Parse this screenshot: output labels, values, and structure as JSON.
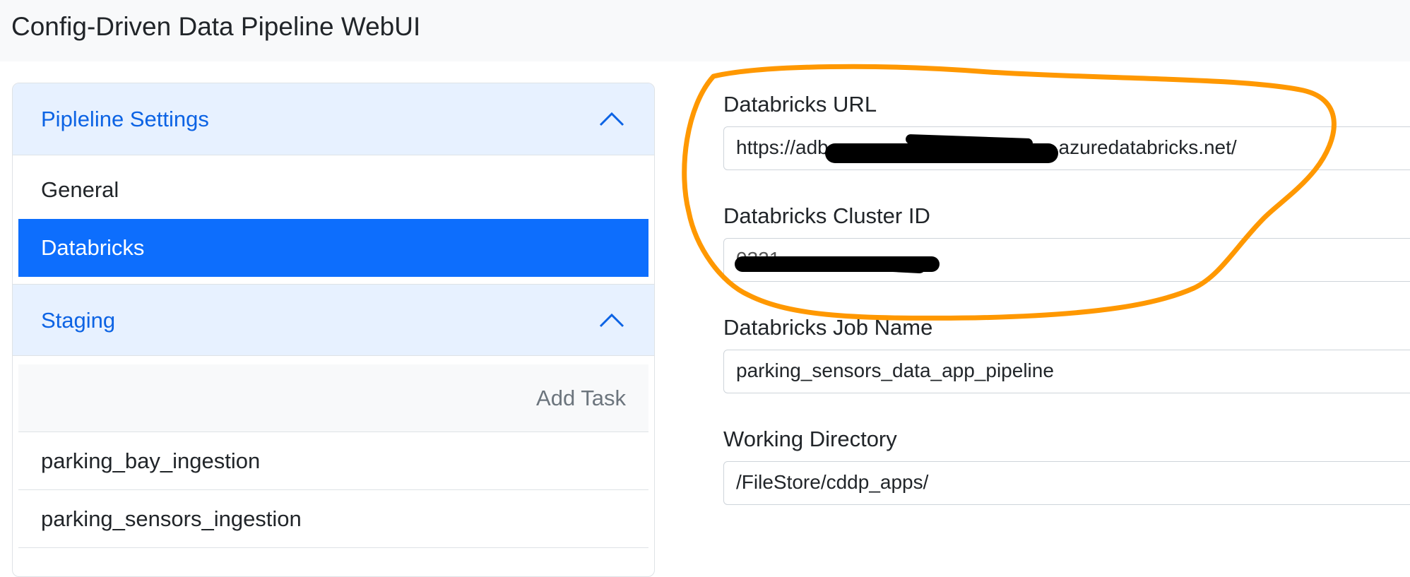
{
  "app": {
    "title": "Config-Driven Data Pipeline WebUI"
  },
  "sidebar": {
    "sections": [
      {
        "title": "Pipleline Settings",
        "items": [
          {
            "label": "General",
            "active": false
          },
          {
            "label": "Databricks",
            "active": true
          }
        ]
      },
      {
        "title": "Staging",
        "add_task_label": "Add Task",
        "tasks": [
          {
            "label": "parking_bay_ingestion"
          },
          {
            "label": "parking_sensors_ingestion"
          }
        ]
      }
    ]
  },
  "form": {
    "databricks_url": {
      "label": "Databricks URL",
      "value_prefix": "https://adb",
      "value_suffix": ".azuredatabricks.net/"
    },
    "cluster_id": {
      "label": "Databricks Cluster ID",
      "value_visible": "0321-"
    },
    "job_name": {
      "label": "Databricks Job Name",
      "value": "parking_sensors_data_app_pipeline"
    },
    "working_directory": {
      "label": "Working Directory",
      "value": "/FileStore/cddp_apps/"
    }
  },
  "colors": {
    "accent": "#0d6efd",
    "accordion_header_bg": "#e7f1ff",
    "accordion_header_text": "#0c63e4",
    "annotation": "#ff9800",
    "redaction": "#000000"
  },
  "icons": {
    "accordion_toggle": "chevron-up-icon"
  }
}
